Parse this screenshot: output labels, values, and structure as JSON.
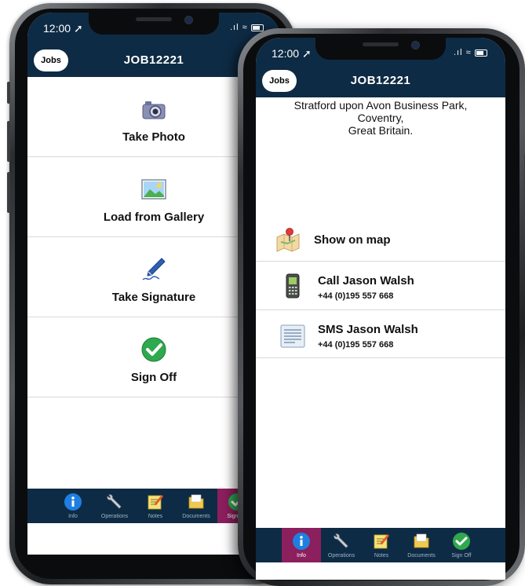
{
  "status": {
    "time": "12:00",
    "signal": ".ıl",
    "wifi": "⫫"
  },
  "left_phone": {
    "jobs_button": "Jobs",
    "title": "JOB12221",
    "actions": [
      {
        "label": "Take Photo",
        "icon": "camera-icon"
      },
      {
        "label": "Load from Gallery",
        "icon": "gallery-icon"
      },
      {
        "label": "Take Signature",
        "icon": "signature-pen-icon"
      },
      {
        "label": "Sign Off",
        "icon": "green-check-icon"
      }
    ],
    "tabs": [
      {
        "label": "Info",
        "icon": "info-icon",
        "active": false
      },
      {
        "label": "Operations",
        "icon": "wrench-icon",
        "active": false
      },
      {
        "label": "Notes",
        "icon": "notes-icon",
        "active": false
      },
      {
        "label": "Documents",
        "icon": "folder-icon",
        "active": false
      },
      {
        "label": "Sign Off",
        "icon": "check-icon",
        "active": true
      }
    ]
  },
  "right_phone": {
    "jobs_button": "Jobs",
    "title": "JOB12221",
    "address": {
      "line1": "Stratford upon Avon Business Park,",
      "line2": "Coventry,",
      "line3": "Great Britain."
    },
    "show_on_map": "Show on map",
    "call": {
      "title": "Call Jason Walsh",
      "number": "+44 (0)195 557 668"
    },
    "sms": {
      "title": "SMS Jason Walsh",
      "number": "+44 (0)195 557 668"
    },
    "tabs": [
      {
        "label": "Info",
        "icon": "info-icon",
        "active": true
      },
      {
        "label": "Operations",
        "icon": "wrench-icon",
        "active": false
      },
      {
        "label": "Notes",
        "icon": "notes-icon",
        "active": false
      },
      {
        "label": "Documents",
        "icon": "folder-icon",
        "active": false
      },
      {
        "label": "Sign Off",
        "icon": "check-icon",
        "active": false
      }
    ]
  },
  "colors": {
    "header": "#0e2b45",
    "active_tab": "#8c1f5d",
    "check_green": "#2fa84f",
    "info_blue": "#1f7fe0"
  }
}
